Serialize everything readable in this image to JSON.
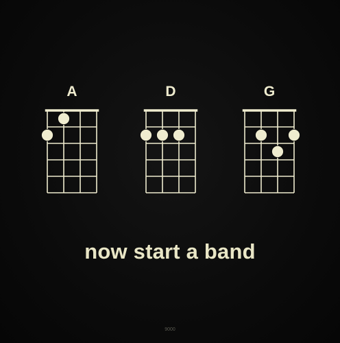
{
  "chords": [
    {
      "name": "A",
      "dots": [
        {
          "string": 0,
          "fret": 2
        },
        {
          "string": 1,
          "fret": 1
        }
      ]
    },
    {
      "name": "D",
      "dots": [
        {
          "string": 0,
          "fret": 2
        },
        {
          "string": 1,
          "fret": 2
        },
        {
          "string": 2,
          "fret": 2
        }
      ]
    },
    {
      "name": "G",
      "dots": [
        {
          "string": 1,
          "fret": 2
        },
        {
          "string": 2,
          "fret": 3
        },
        {
          "string": 3,
          "fret": 2
        }
      ]
    }
  ],
  "tagline": "now start a band",
  "footer_code": "9000",
  "colors": {
    "background": "#0b0b0b",
    "ink": "#efeccf"
  }
}
